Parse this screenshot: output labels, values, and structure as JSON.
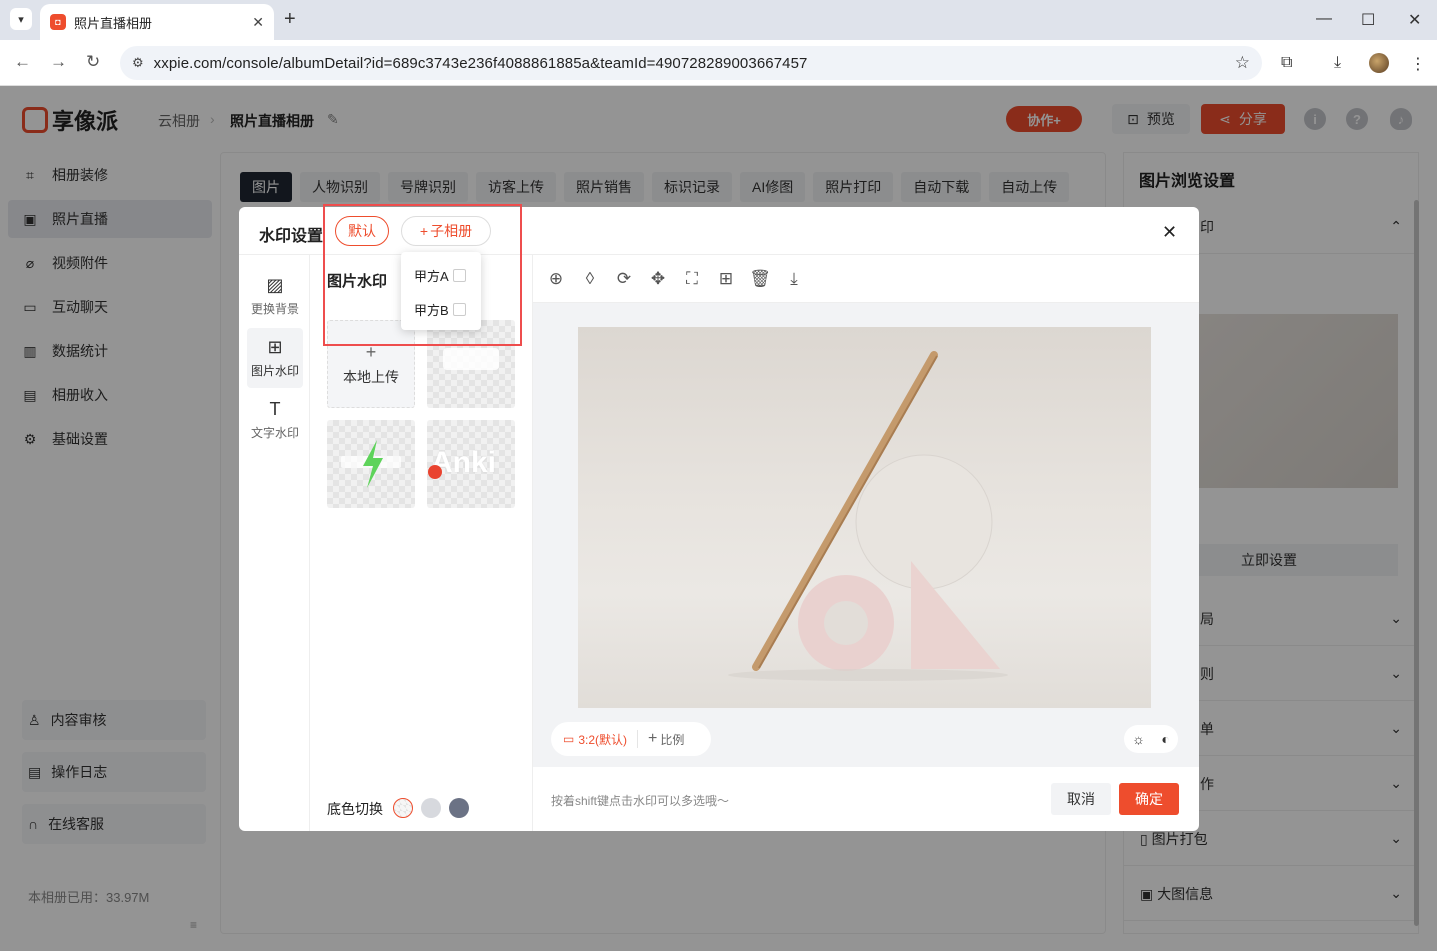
{
  "browser": {
    "tab_title": "照片直播相册",
    "url": "xxpie.com/console/albumDetail?id=689c3743e236f4088861885a&teamId=490728289003667457"
  },
  "app": {
    "logo_text": "享像派",
    "breadcrumb": [
      "云相册",
      "照片直播相册"
    ],
    "collab_label": "协作+",
    "preview_label": "预览",
    "share_label": "分享",
    "sidebar": [
      {
        "label": "相册装修",
        "icon": "brush-icon"
      },
      {
        "label": "照片直播",
        "icon": "image-icon"
      },
      {
        "label": "视频附件",
        "icon": "clip-icon"
      },
      {
        "label": "互动聊天",
        "icon": "chat-icon"
      },
      {
        "label": "数据统计",
        "icon": "chart-icon"
      },
      {
        "label": "相册收入",
        "icon": "shop-icon"
      },
      {
        "label": "基础设置",
        "icon": "gear-icon"
      }
    ],
    "sidebar_bottom": [
      "内容审核",
      "操作日志",
      "在线客服"
    ],
    "storage": "本相册已用：33.97M",
    "tabs": [
      "图片",
      "人物识别",
      "号牌识别",
      "访客上传",
      "照片销售",
      "标识记录",
      "AI修图",
      "照片打印",
      "自动下载",
      "自动上传"
    ],
    "right_panel": {
      "title": "图片浏览设置",
      "sections": [
        "印",
        "局",
        "则",
        "单",
        "作",
        "图片打包",
        "大图信息"
      ],
      "set_now": "立即设置"
    }
  },
  "dialog": {
    "title": "水印设置",
    "pill_default": "默认",
    "pill_sub": "子相册",
    "dropdown": [
      "甲方A",
      "甲方B"
    ],
    "vtabs": [
      "更换背景",
      "图片水印",
      "文字水印"
    ],
    "section_title": "图片水印",
    "upload_label": "本地上传",
    "base_color_label": "底色切换",
    "base_colors": [
      "#f3d2d0",
      "#d7d9de",
      "#6b7285"
    ],
    "ratio_label": "3:2(默认)",
    "ratio_add": "比例",
    "hint": "按着shift键点击水印可以多选哦～",
    "cancel": "取消",
    "ok": "确定",
    "watermark_text_1": "Anki"
  }
}
